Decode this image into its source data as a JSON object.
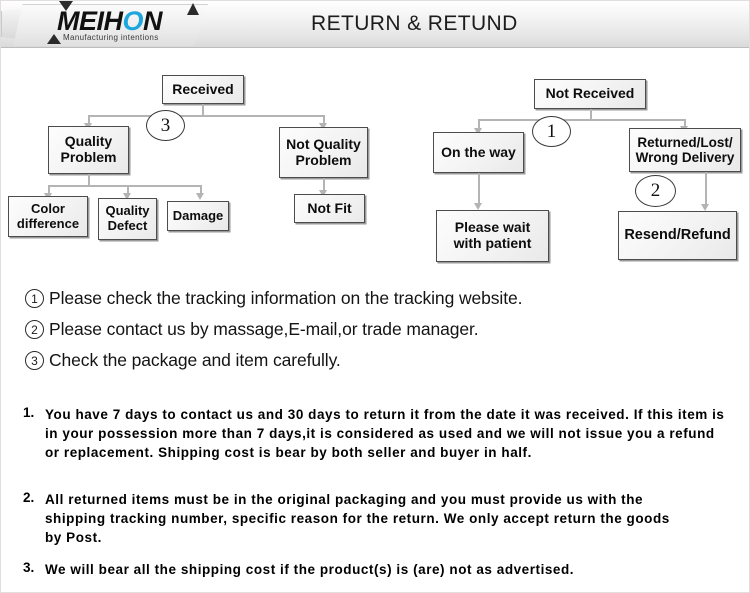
{
  "header": {
    "title": "RETURN & RETUND",
    "logo": {
      "word_primary": "MEIH",
      "word_accent": "O",
      "word_suffix": "N",
      "tagline": "Manufacturing intentions",
      "accent_color": "#1ea7dd"
    }
  },
  "flowchart": {
    "left": {
      "root": "Received",
      "branch_quality": "Quality\nProblem",
      "branch_not_quality": "Not Quality\nProblem",
      "leaf_color": "Color\ndifference",
      "leaf_defect": "Quality\nDefect",
      "leaf_damage": "Damage",
      "leaf_not_fit": "Not Fit",
      "marker": "3"
    },
    "right": {
      "root": "Not  Received",
      "branch_on_the_way": "On the way",
      "branch_returned": "Returned/Lost/\nWrong Delivery",
      "leaf_wait": "Please wait\nwith patient",
      "leaf_resend": "Resend/Refund",
      "marker_root": "1",
      "marker_returned": "2"
    }
  },
  "notes": [
    {
      "num": "1",
      "text": "Please check the tracking information on the tracking website."
    },
    {
      "num": "2",
      "text": "Please contact us by  massage,E-mail,or trade manager."
    },
    {
      "num": "3",
      "text": "Check the package and item carefully."
    }
  ],
  "terms": [
    {
      "num": "1.",
      "text": "You have 7 days to contact us and 30 days to return it from the date it was received. If this item is in your possession more than 7 days,it is considered as used and we will not issue you a refund or replacement. Shipping cost is bear by both seller and buyer in half."
    },
    {
      "num": "2.",
      "text": "All returned items must be in the original packaging and you must provide us with the shipping tracking number, specific reason for the return. We only accept return the goods by Post."
    },
    {
      "num": "3.",
      "text": "We will bear all the shipping cost if the product(s) is (are) not as advertised."
    }
  ]
}
